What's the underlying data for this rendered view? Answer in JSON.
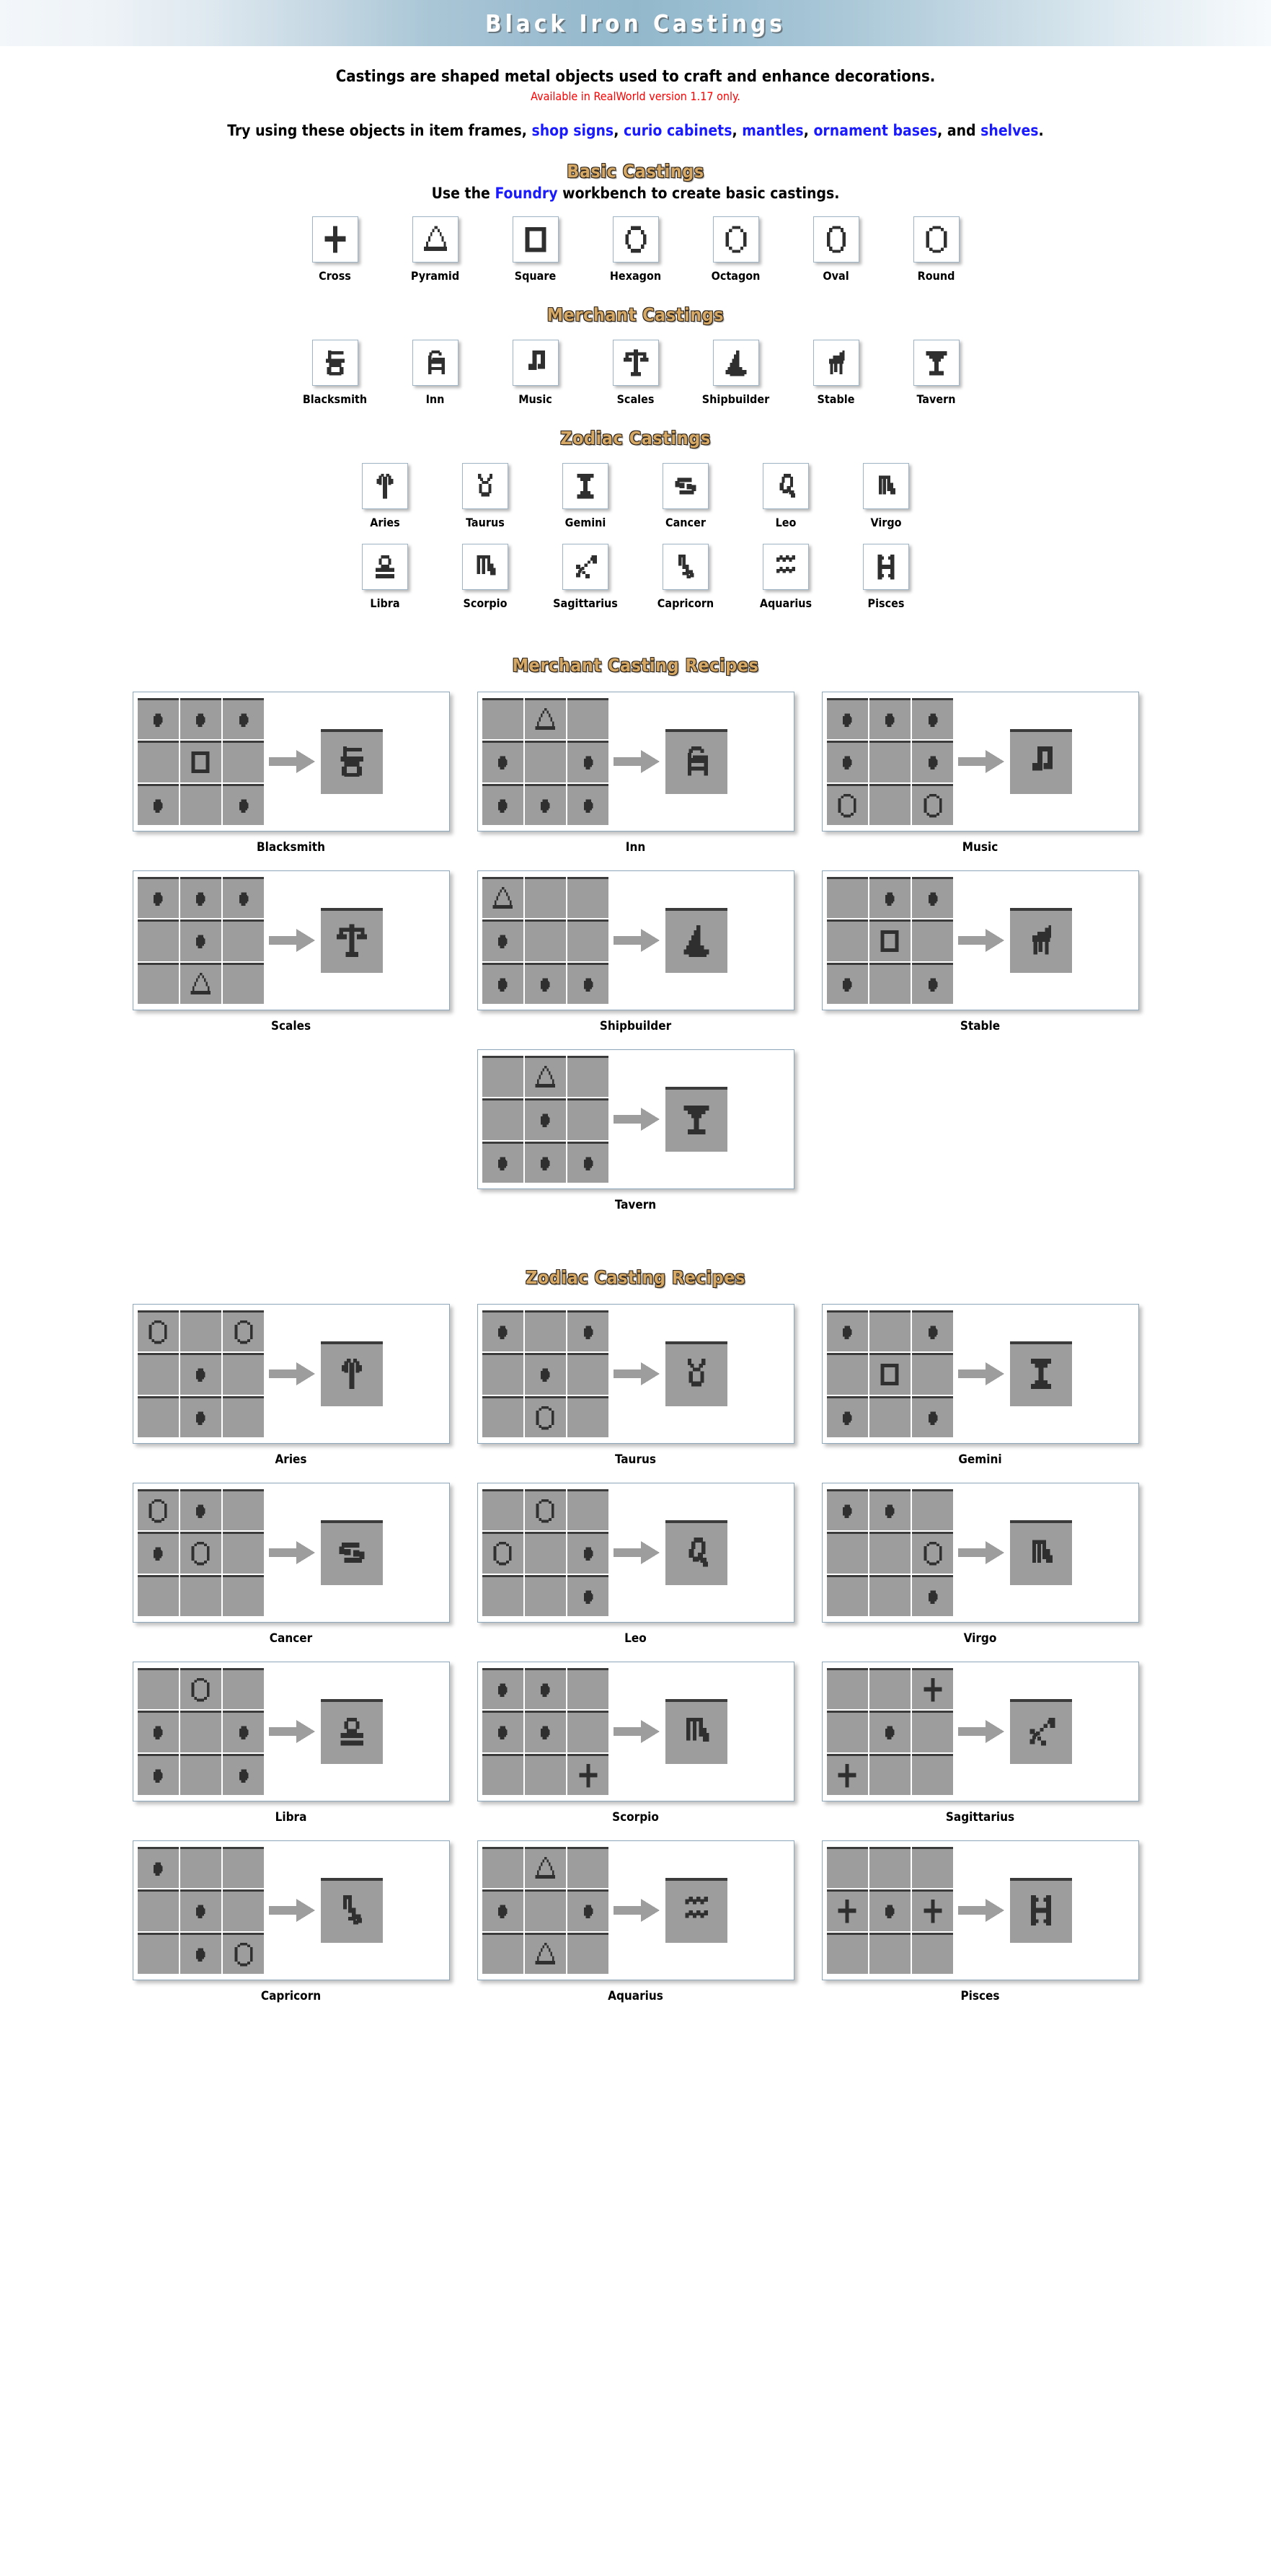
{
  "banner": {
    "title": "Black Iron Castings"
  },
  "intro": {
    "line1": "Castings are shaped metal objects used to craft and enhance decorations.",
    "line2": "Available in RealWorld version 1.17 only.",
    "line3_pre": "Try using these objects in item frames, ",
    "links": [
      "shop signs",
      "curio cabinets",
      "mantles",
      "ornament bases",
      "shelves"
    ],
    "line3_sep1": ", ",
    "line3_sep_and": ", and ",
    "line3_end": "."
  },
  "sections": {
    "basic": {
      "heading": "Basic Castings",
      "sub_pre": "Use the ",
      "sub_link": "Foundry",
      "sub_post": " workbench to create basic castings.",
      "items": [
        {
          "label": "Cross",
          "icon": "cross-casting-icon"
        },
        {
          "label": "Pyramid",
          "icon": "pyramid-casting-icon"
        },
        {
          "label": "Square",
          "icon": "square-casting-icon"
        },
        {
          "label": "Hexagon",
          "icon": "hexagon-casting-icon"
        },
        {
          "label": "Octagon",
          "icon": "octagon-casting-icon"
        },
        {
          "label": "Oval",
          "icon": "oval-casting-icon"
        },
        {
          "label": "Round",
          "icon": "round-casting-icon"
        }
      ]
    },
    "merchant": {
      "heading": "Merchant Castings",
      "items": [
        {
          "label": "Blacksmith",
          "icon": "anvil-icon"
        },
        {
          "label": "Inn",
          "icon": "bed-icon"
        },
        {
          "label": "Music",
          "icon": "music-note-icon"
        },
        {
          "label": "Scales",
          "icon": "scales-icon"
        },
        {
          "label": "Shipbuilder",
          "icon": "sailboat-icon"
        },
        {
          "label": "Stable",
          "icon": "horse-icon"
        },
        {
          "label": "Tavern",
          "icon": "cocktail-glass-icon"
        }
      ]
    },
    "zodiac": {
      "heading": "Zodiac Castings",
      "row1": [
        {
          "label": "Aries",
          "icon": "aries-icon"
        },
        {
          "label": "Taurus",
          "icon": "taurus-icon"
        },
        {
          "label": "Gemini",
          "icon": "gemini-icon"
        },
        {
          "label": "Cancer",
          "icon": "cancer-icon"
        },
        {
          "label": "Leo",
          "icon": "leo-icon"
        },
        {
          "label": "Virgo",
          "icon": "virgo-icon"
        }
      ],
      "row2": [
        {
          "label": "Libra",
          "icon": "libra-icon"
        },
        {
          "label": "Scorpio",
          "icon": "scorpio-icon"
        },
        {
          "label": "Sagittarius",
          "icon": "sagittarius-icon"
        },
        {
          "label": "Capricorn",
          "icon": "capricorn-icon"
        },
        {
          "label": "Aquarius",
          "icon": "aquarius-icon"
        },
        {
          "label": "Pisces",
          "icon": "pisces-icon"
        }
      ]
    },
    "merchant_recipes": {
      "heading": "Merchant Casting Recipes",
      "recipes": [
        {
          "label": "Blacksmith",
          "result": "anvil-icon",
          "grid": [
            "nugget",
            "nugget",
            "nugget",
            "",
            "square",
            "",
            "nugget",
            "",
            "nugget"
          ]
        },
        {
          "label": "Inn",
          "result": "bed-icon",
          "grid": [
            "",
            "pyramid",
            "",
            "nugget",
            "",
            "nugget",
            "nugget",
            "nugget",
            "nugget"
          ]
        },
        {
          "label": "Music",
          "result": "music-note-icon",
          "grid": [
            "nugget",
            "nugget",
            "nugget",
            "nugget",
            "",
            "nugget",
            "round",
            "",
            "round"
          ]
        },
        {
          "label": "Scales",
          "result": "scales-icon",
          "grid": [
            "nugget",
            "nugget",
            "nugget",
            "",
            "nugget",
            "",
            "",
            "pyramid",
            ""
          ]
        },
        {
          "label": "Shipbuilder",
          "result": "sailboat-icon",
          "grid": [
            "pyramid",
            "",
            "",
            "nugget",
            "",
            "",
            "nugget",
            "nugget",
            "nugget"
          ]
        },
        {
          "label": "Stable",
          "result": "horse-icon",
          "grid": [
            "",
            "nugget",
            "nugget",
            "",
            "square",
            "",
            "nugget",
            "",
            "nugget"
          ]
        },
        {
          "label": "Tavern",
          "result": "cocktail-glass-icon",
          "grid": [
            "",
            "pyramid",
            "",
            "",
            "nugget",
            "",
            "nugget",
            "nugget",
            "nugget"
          ]
        }
      ]
    },
    "zodiac_recipes": {
      "heading": "Zodiac Casting Recipes",
      "recipes": [
        {
          "label": "Aries",
          "result": "aries-icon",
          "grid": [
            "round",
            "",
            "round",
            "",
            "nugget",
            "",
            "",
            "nugget",
            ""
          ]
        },
        {
          "label": "Taurus",
          "result": "taurus-icon",
          "grid": [
            "nugget",
            "",
            "nugget",
            "",
            "nugget",
            "",
            "",
            "round",
            ""
          ]
        },
        {
          "label": "Gemini",
          "result": "gemini-icon",
          "grid": [
            "nugget",
            "",
            "nugget",
            "",
            "square",
            "",
            "nugget",
            "",
            "nugget"
          ]
        },
        {
          "label": "Cancer",
          "result": "cancer-icon",
          "grid": [
            "round",
            "nugget",
            "",
            "nugget",
            "round",
            "",
            "",
            "",
            ""
          ]
        },
        {
          "label": "Leo",
          "result": "leo-icon",
          "grid": [
            "",
            "round",
            "",
            "round",
            "",
            "nugget",
            "",
            "",
            "nugget"
          ]
        },
        {
          "label": "Virgo",
          "result": "virgo-icon",
          "grid": [
            "nugget",
            "nugget",
            "",
            "",
            "",
            "round",
            "",
            "",
            "nugget"
          ]
        },
        {
          "label": "Libra",
          "result": "libra-icon",
          "grid": [
            "",
            "round",
            "",
            "nugget",
            "",
            "nugget",
            "nugget",
            "",
            "nugget"
          ]
        },
        {
          "label": "Scorpio",
          "result": "scorpio-icon",
          "grid": [
            "nugget",
            "nugget",
            "",
            "nugget",
            "nugget",
            "",
            "",
            "",
            "cross"
          ]
        },
        {
          "label": "Sagittarius",
          "result": "sagittarius-icon",
          "grid": [
            "",
            "",
            "cross",
            "",
            "nugget",
            "",
            "cross",
            "",
            ""
          ]
        },
        {
          "label": "Capricorn",
          "result": "capricorn-icon",
          "grid": [
            "nugget",
            "",
            "",
            "",
            "nugget",
            "",
            "",
            "nugget",
            "round"
          ]
        },
        {
          "label": "Aquarius",
          "result": "aquarius-icon",
          "grid": [
            "",
            "pyramid",
            "",
            "nugget",
            "",
            "nugget",
            "",
            "pyramid",
            ""
          ]
        },
        {
          "label": "Pisces",
          "result": "pisces-icon",
          "grid": [
            "",
            "",
            "",
            "cross",
            "nugget",
            "cross",
            "",
            "",
            ""
          ]
        }
      ]
    }
  },
  "colors": {
    "heading_fill": "#d6a865",
    "heading_outline": "#2a2118",
    "link": "#1a1aff",
    "warning": "#ff0000",
    "cell_bg": "#9d9d9d",
    "cell_edge": "#3b3b3b",
    "banner_mid": "#93b8cc"
  }
}
